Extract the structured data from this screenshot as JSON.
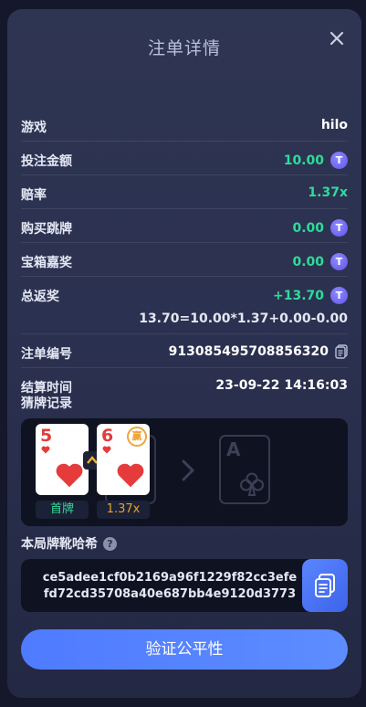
{
  "dialog": {
    "title": "注单详情"
  },
  "details": {
    "game_label": "游戏",
    "game_value": "hilo",
    "bet_label": "投注金额",
    "bet_value": "10.00",
    "odds_label": "赔率",
    "odds_value": "1.37x",
    "buy_skip_label": "购买跳牌",
    "buy_skip_value": "0.00",
    "chest_label": "宝箱嘉奖",
    "chest_value": "0.00",
    "payout_label": "总返奖",
    "payout_value": "+13.70",
    "payout_formula": "13.70=10.00*1.37+0.00-0.00",
    "order_label": "注单编号",
    "order_value": "913085495708856320",
    "settle_label": "结算时间",
    "settle_value": "23-09-22 14:16:03"
  },
  "guess": {
    "label": "猜牌记录",
    "cards": [
      {
        "rank": "5",
        "suit": "heart",
        "tag": "首牌"
      },
      {
        "rank": "6",
        "suit": "heart",
        "tag": "1.37x",
        "badge": "赢"
      }
    ],
    "ghost_rank": "A",
    "ghost_suit": "club"
  },
  "hash": {
    "label": "本局牌靴哈希",
    "line1": "ce5adee1cf0b2169a96f1229f82cc3efe",
    "line2": "fd72cd35708a40e687bb4e9120d3773"
  },
  "actions": {
    "verify_label": "验证公平性"
  },
  "colors": {
    "accent": "#5a86ff",
    "positive": "#2fdb9a",
    "coin": "#6b62f0",
    "odds_tag": "#e8a22a"
  },
  "icons": [
    "close-icon",
    "coin-icon",
    "copy-icon",
    "help-icon",
    "heart-icon",
    "club-icon",
    "chevron-right-icon",
    "arrow-up-icon",
    "win-badge-icon"
  ]
}
